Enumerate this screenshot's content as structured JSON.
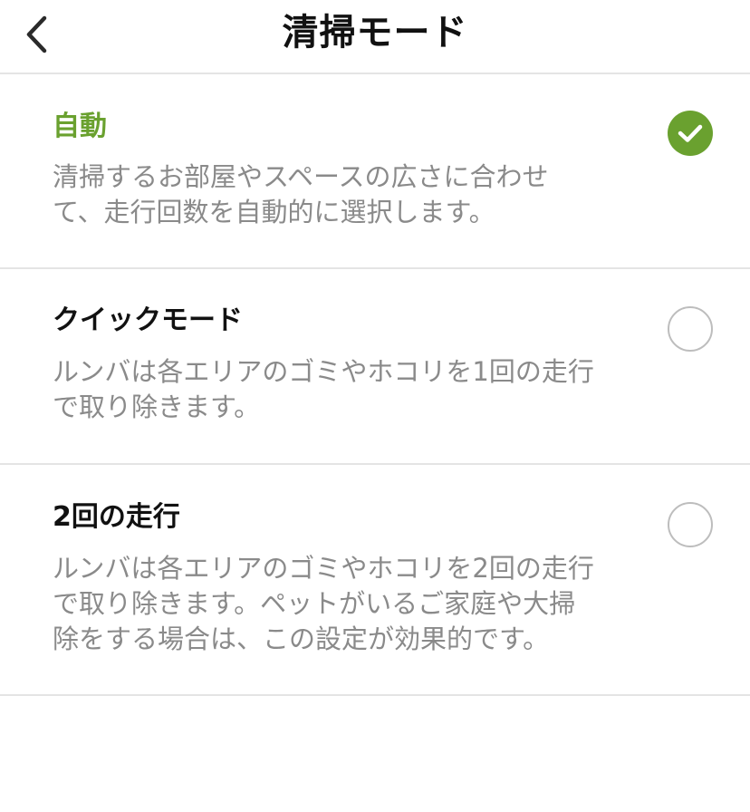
{
  "header": {
    "title": "清掃モード",
    "back_icon": "chevron-left-icon"
  },
  "colors": {
    "accent": "#6aa12f",
    "title_text": "#111111",
    "description_text": "#8a8a8a",
    "divider": "#e4e4e4",
    "radio_border": "#bdbdbd"
  },
  "options": [
    {
      "title": "自動",
      "description": "清掃するお部屋やスペースの広さに合わせ\nて、走行回数を自動的に選択します。",
      "selected": true,
      "icon": "check-circle-icon"
    },
    {
      "title": "クイックモード",
      "description": "ルンバは各エリアのゴミやホコリを1回の走行\nで取り除きます。",
      "selected": false,
      "icon": "radio-empty-icon"
    },
    {
      "title": "2回の走行",
      "description": "ルンバは各エリアのゴミやホコリを2回の走行\nで取り除きます。ペットがいるご家庭や大掃\n除をする場合は、この設定が効果的です。",
      "selected": false,
      "icon": "radio-empty-icon"
    }
  ]
}
